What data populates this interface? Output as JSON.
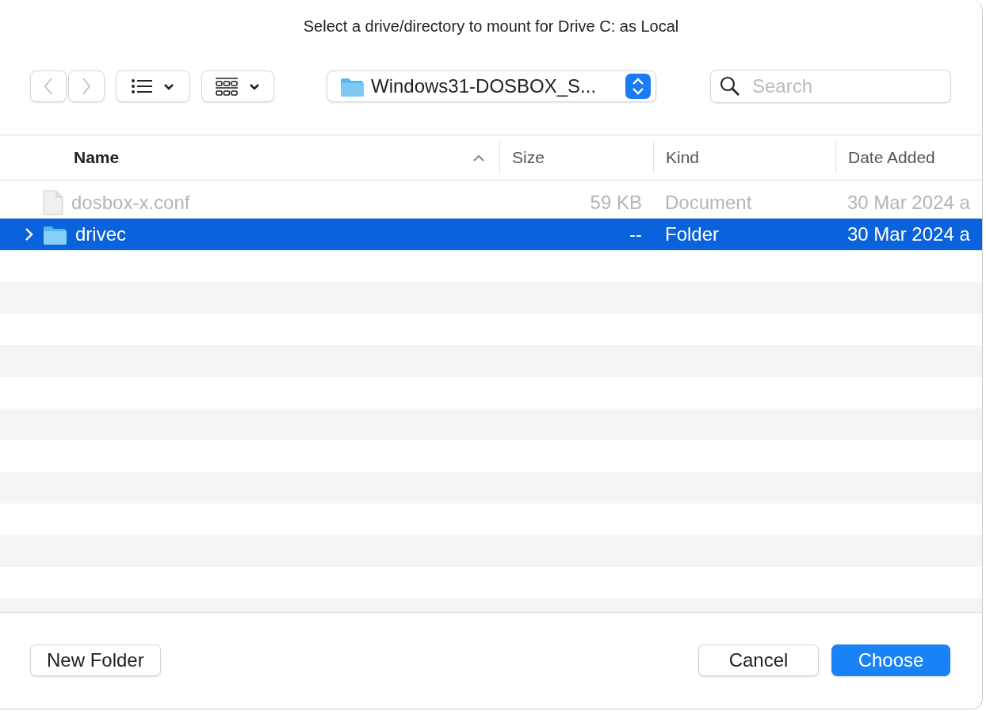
{
  "window": {
    "title": "Select a drive/directory to mount for Drive C: as Local"
  },
  "toolbar": {
    "location": "Windows31-DOSBOX_S...",
    "search": {
      "placeholder": "Search"
    }
  },
  "table": {
    "columns": [
      {
        "label": "Name",
        "sorted": true
      },
      {
        "label": "Size",
        "sorted": false
      },
      {
        "label": "Kind",
        "sorted": false
      },
      {
        "label": "Date Added",
        "sorted": false
      }
    ],
    "rows": [
      {
        "kind": "file",
        "name": "dosbox-x.conf",
        "size": "59 KB",
        "type": "Document",
        "date": "30 Mar 2024 a",
        "disabled": true,
        "selected": false
      },
      {
        "kind": "folder",
        "name": "drivec",
        "size": "--",
        "type": "Folder",
        "date": "30 Mar 2024 a",
        "disabled": false,
        "selected": true,
        "expanded": false
      }
    ]
  },
  "buttons": [
    {
      "kind": "plain",
      "label": "New Folder"
    },
    {
      "kind": "plain",
      "label": "Cancel"
    },
    {
      "kind": "default",
      "label": "Choose"
    }
  ]
}
